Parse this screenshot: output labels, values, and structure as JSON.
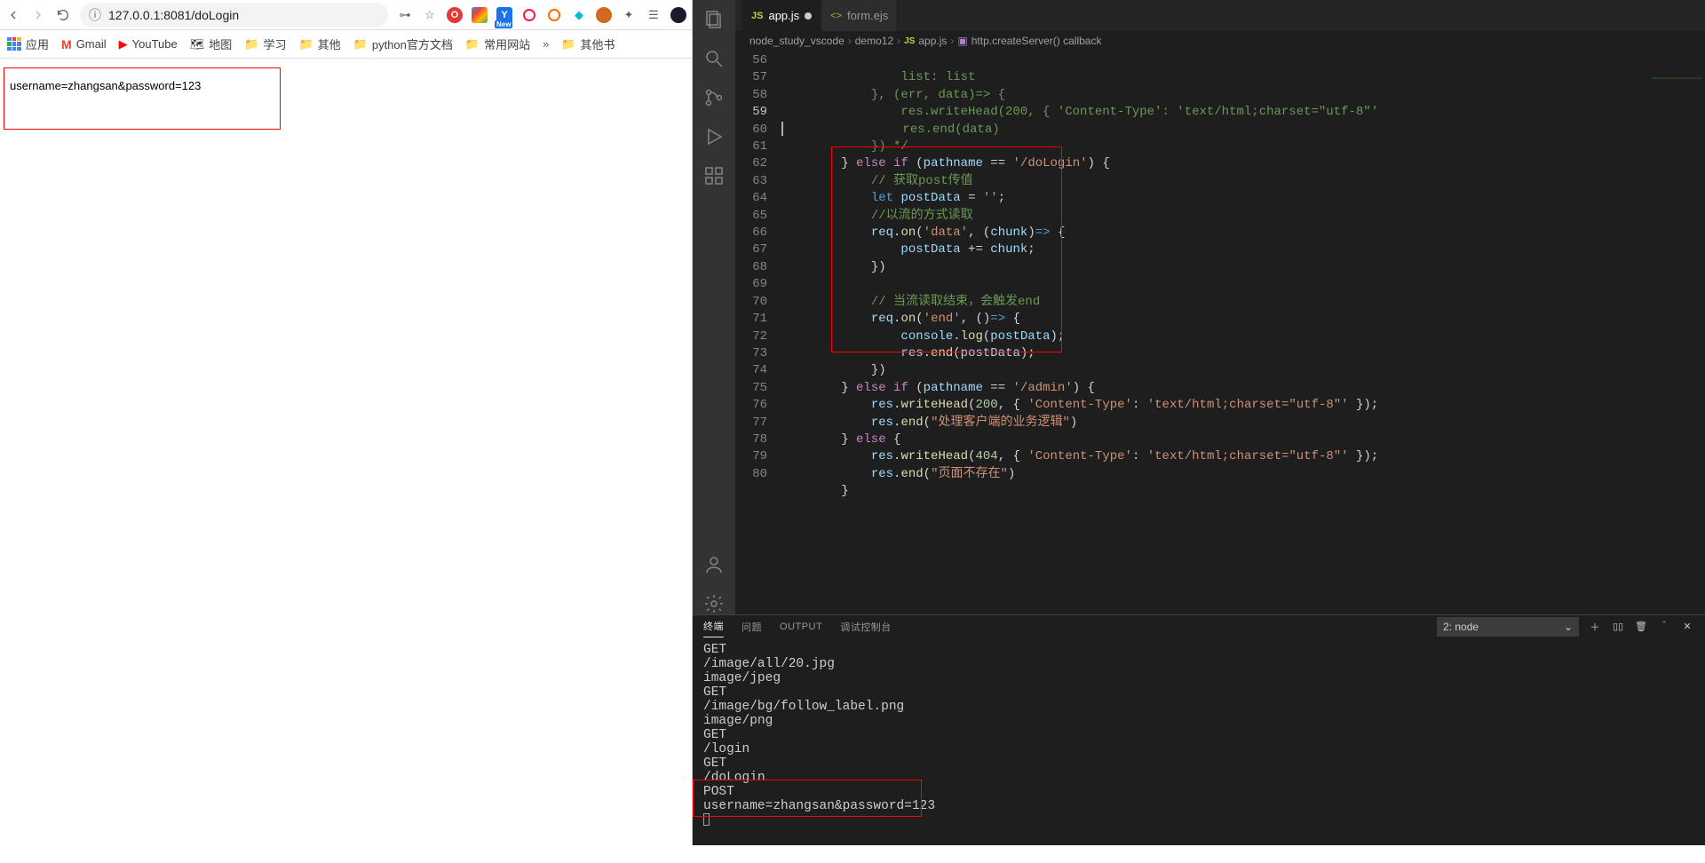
{
  "browser": {
    "url": "127.0.0.1:8081/doLogin",
    "bookmarks": {
      "apps": "应用",
      "gmail": "Gmail",
      "youtube": "YouTube",
      "maps": "地图",
      "study": "学习",
      "other": "其他",
      "python": "python官方文档",
      "common": "常用网站",
      "other_bm": "其他书"
    },
    "page_output": "username=zhangsan&password=123"
  },
  "vscode": {
    "tabs": {
      "app": "app.js",
      "form": "form.ejs"
    },
    "breadcrumb": {
      "root": "node_study_vscode",
      "folder": "demo12",
      "file": "app.js",
      "symbol": "http.createServer() callback"
    },
    "code": {
      "line_start": 56,
      "l56": "        }, (err, data)=> {",
      "l57": "            res.writeHead(200, { 'Content-Type': 'text/html;charset=\"utf-8\"'",
      "l58": "            res.end(data)",
      "l59": "        }) */",
      "l60": "} else if (pathname == '/doLogin') {",
      "l61": "    // 获取post传值",
      "l62": "    let postData = '';",
      "l63": "    //以流的方式读取",
      "l64": "    req.on('data', (chunk)=> {",
      "l65": "        postData += chunk;",
      "l66": "    })",
      "l67": "",
      "l68": "    // 当流读取结束，会触发end",
      "l69": "    req.on('end', ()=> {",
      "l70": "        console.log(postData);",
      "l71": "        res.end(postData);",
      "l72": "    })",
      "l73": "} else if (pathname == '/admin') {",
      "l74": "    res.writeHead(200, { 'Content-Type': 'text/html;charset=\"utf-8\"' });",
      "l75": "    res.end(\"处理客户端的业务逻辑\")",
      "l76": "} else {",
      "l77": "    res.writeHead(404, { 'Content-Type': 'text/html;charset=\"utf-8\"' });",
      "l78": "    res.end(\"页面不存在\")",
      "l79": "}"
    },
    "panel": {
      "tabs": {
        "terminal": "终端",
        "problems": "问题",
        "output": "OUTPUT",
        "debug": "调试控制台"
      },
      "term_select": "2: node",
      "output": "GET\n/image/all/20.jpg\nimage/jpeg\nGET\n/image/bg/follow_label.png\nimage/png\nGET\n/login\nGET\n/doLogin\nPOST\nusername=zhangsan&password=123"
    }
  }
}
